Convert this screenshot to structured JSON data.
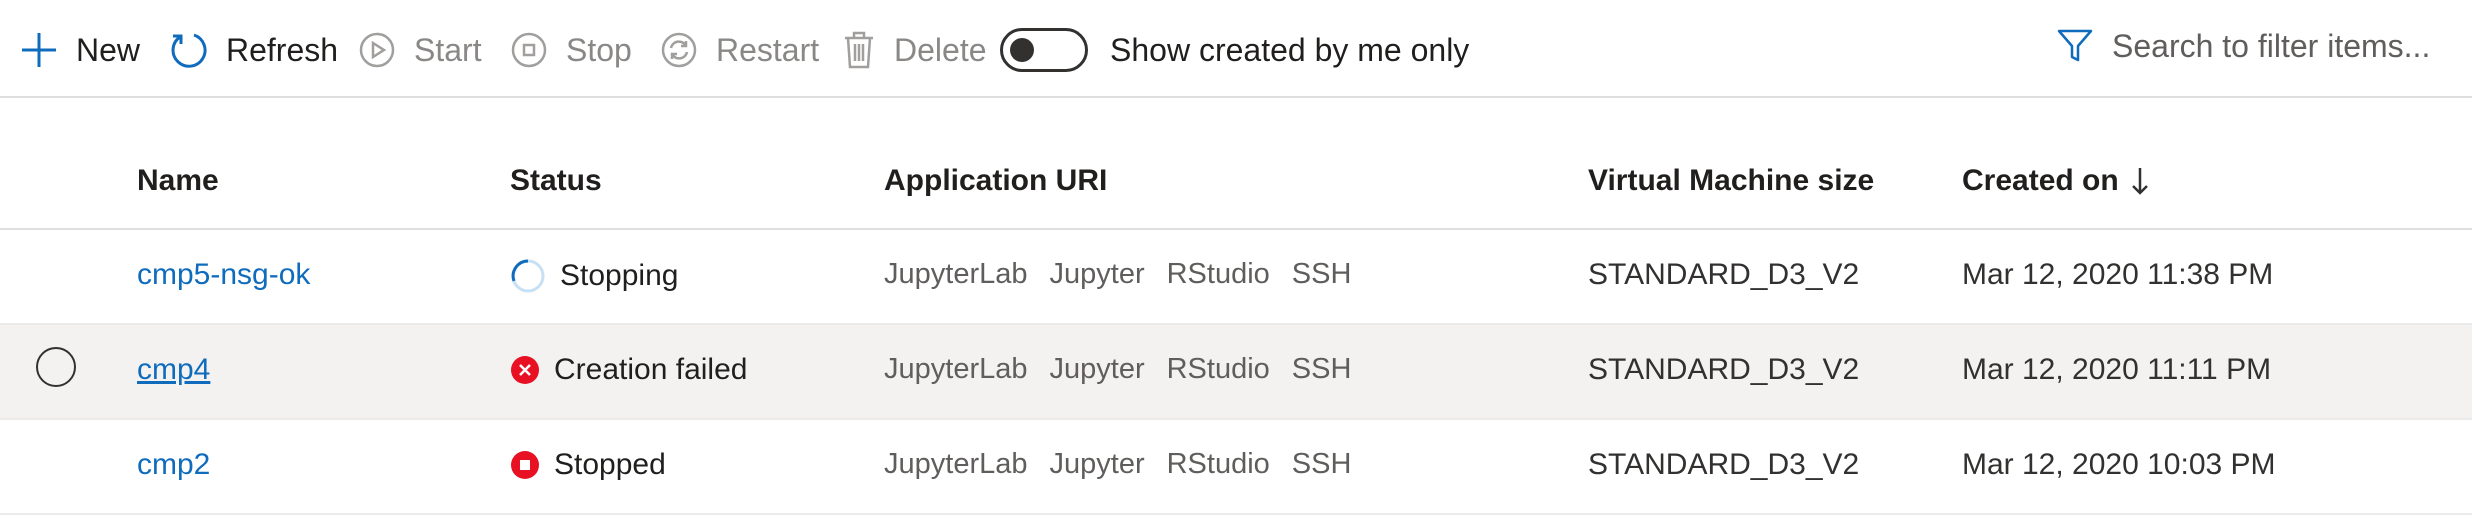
{
  "toolbar": {
    "new_label": "New",
    "refresh_label": "Refresh",
    "start_label": "Start",
    "stop_label": "Stop",
    "restart_label": "Restart",
    "delete_label": "Delete",
    "toggle_label": "Show created by me only",
    "toggle_on": false,
    "search_placeholder": "Search to filter items..."
  },
  "table": {
    "columns": {
      "name": "Name",
      "status": "Status",
      "uri": "Application URI",
      "vm_size": "Virtual Machine size",
      "created": "Created on"
    },
    "sort_column": "created",
    "sort_direction": "descending",
    "rows": [
      {
        "name": "cmp5-nsg-ok",
        "status": "Stopping",
        "status_icon": "spinner-icon",
        "uris": [
          "JupyterLab",
          "Jupyter",
          "RStudio",
          "SSH"
        ],
        "vm_size": "STANDARD_D3_V2",
        "created": "Mar 12, 2020 11:38 PM"
      },
      {
        "name": "cmp4",
        "status": "Creation failed",
        "status_icon": "error-icon",
        "uris": [
          "JupyterLab",
          "Jupyter",
          "RStudio",
          "SSH"
        ],
        "vm_size": "STANDARD_D3_V2",
        "created": "Mar 12, 2020 11:11 PM"
      },
      {
        "name": "cmp2",
        "status": "Stopped",
        "status_icon": "stopped-icon",
        "uris": [
          "JupyterLab",
          "Jupyter",
          "RStudio",
          "SSH"
        ],
        "vm_size": "STANDARD_D3_V2",
        "created": "Mar 12, 2020 10:03 PM"
      }
    ]
  },
  "colors": {
    "link": "#0f6cbd",
    "accent_icon": "#0f6cbd",
    "error": "#e81123",
    "disabled": "#8a8886",
    "selected_row": "#f3f2f1"
  }
}
